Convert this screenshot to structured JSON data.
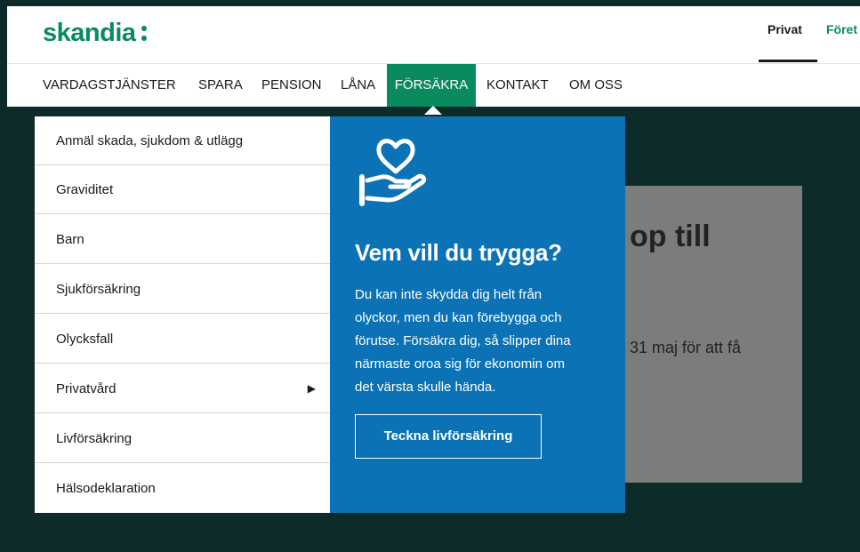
{
  "brand": {
    "logo_text": "skandia"
  },
  "segments": {
    "privat": "Privat",
    "foretag": "Föret"
  },
  "nav": {
    "items": [
      "VARDAGSTJÄNSTER",
      "SPARA",
      "PENSION",
      "LÅNA",
      "FÖRSÄKRA",
      "KONTAKT",
      "OM OSS"
    ],
    "active": "FÖRSÄKRA"
  },
  "hero": {
    "title_fragment": "op till",
    "text_fragment": "31 maj för att få"
  },
  "dropdown": {
    "items": [
      "Anmäl skada, sjukdom & utlägg",
      "Graviditet",
      "Barn",
      "Sjukförsäkring",
      "Olycksfall",
      "Privatvård",
      "Livförsäkring",
      "Hälsodeklaration"
    ],
    "submenu_arrow": "▶"
  },
  "promo": {
    "icon": "heart-in-hand-icon",
    "heading": "Vem vill du trygga?",
    "body_lines": [
      "Du kan inte skydda dig helt från",
      "olyckor, men du kan förebygga och",
      "förutse. Försäkra dig, så slipper dina",
      "närmaste oroa sig för ekonomin om",
      "det värsta skulle hända."
    ],
    "button": "Teckna livförsäkring"
  },
  "colors": {
    "brand_green": "#0a8a5f",
    "promo_blue": "#0a72b5",
    "page_dark": "#0d2b28"
  }
}
